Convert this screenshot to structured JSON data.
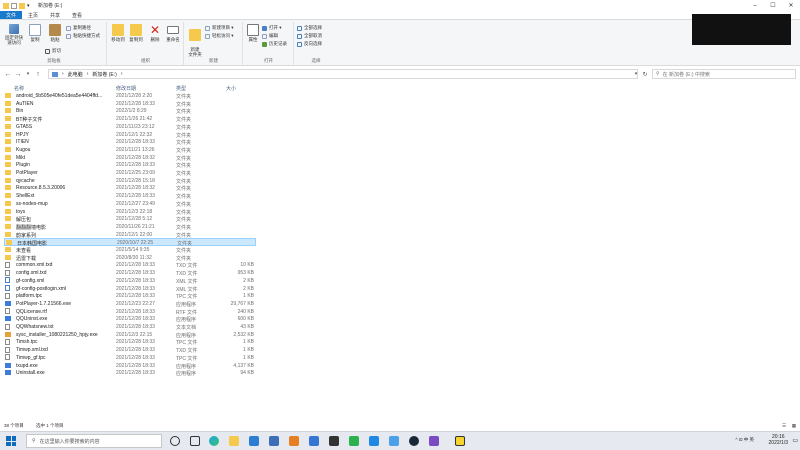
{
  "window": {
    "title": "新加卷 (E:)"
  },
  "tabs": [
    "文件",
    "主页",
    "共享",
    "查看"
  ],
  "ribbon": {
    "clipboard": {
      "name": "剪贴板",
      "pin": "固定到快速访问",
      "copy": "复制",
      "paste": "粘贴",
      "cut": "剪切",
      "copy_path": "复制路径",
      "paste_shortcut": "粘贴快捷方式"
    },
    "organize": {
      "name": "组织",
      "move_to": "移动到",
      "copy_to": "复制到",
      "delete": "删除",
      "rename": "重命名"
    },
    "new": {
      "name": "新建",
      "new_folder": "新建\n文件夹",
      "new_item": "新建项目 ▾",
      "easy_access": "轻松访问 ▾"
    },
    "open": {
      "name": "打开",
      "properties": "属性",
      "open": "打开 ▾",
      "edit": "编辑",
      "history": "历史记录"
    },
    "select": {
      "name": "选择",
      "select_all": "全部选择",
      "select_none": "全部取消",
      "invert": "反向选择"
    }
  },
  "address": {
    "path": [
      "此电脑",
      "新加卷 (E:)"
    ],
    "search_placeholder": "在 新加卷 (E:) 中搜索"
  },
  "columns": {
    "name": "名称",
    "date": "修改日期",
    "type": "类型",
    "size": "大小"
  },
  "files": [
    {
      "name": "android_5b505e40fe51dea5e4404ffd...",
      "date": "2021/12/28 2:20",
      "type": "文件夹",
      "size": "",
      "kind": "folder"
    },
    {
      "name": "AuTIEN",
      "date": "2021/12/28 18:33",
      "type": "文件夹",
      "size": "",
      "kind": "folder"
    },
    {
      "name": "Bin",
      "date": "2022/1/2 8:29",
      "type": "文件夹",
      "size": "",
      "kind": "folder"
    },
    {
      "name": "BT种子文件",
      "date": "2021/1/26 21:42",
      "type": "文件夹",
      "size": "",
      "kind": "folder"
    },
    {
      "name": "GTA5S",
      "date": "2021/11/23 23:12",
      "type": "文件夹",
      "size": "",
      "kind": "folder"
    },
    {
      "name": "HPJY",
      "date": "2021/12/1 22:32",
      "type": "文件夹",
      "size": "",
      "kind": "folder"
    },
    {
      "name": "ITIEN",
      "date": "2021/12/28 18:33",
      "type": "文件夹",
      "size": "",
      "kind": "folder"
    },
    {
      "name": "Kugou",
      "date": "2021/11/21 13:26",
      "type": "文件夹",
      "size": "",
      "kind": "folder"
    },
    {
      "name": "Mikt",
      "date": "2021/12/28 18:32",
      "type": "文件夹",
      "size": "",
      "kind": "folder"
    },
    {
      "name": "Plugin",
      "date": "2021/12/28 18:33",
      "type": "文件夹",
      "size": "",
      "kind": "folder"
    },
    {
      "name": "PotPlayer",
      "date": "2021/12/25 23:09",
      "type": "文件夹",
      "size": "",
      "kind": "folder"
    },
    {
      "name": "qycache",
      "date": "2021/12/28 15:18",
      "type": "文件夹",
      "size": "",
      "kind": "folder"
    },
    {
      "name": "Resource.8.5.3.20006",
      "date": "2021/12/28 18:32",
      "type": "文件夹",
      "size": "",
      "kind": "folder"
    },
    {
      "name": "ShellExt",
      "date": "2021/12/28 18:33",
      "type": "文件夹",
      "size": "",
      "kind": "folder"
    },
    {
      "name": "ss-nodes-mup",
      "date": "2021/12/27 23:49",
      "type": "文件夹",
      "size": "",
      "kind": "folder"
    },
    {
      "name": "toys",
      "date": "2021/12/3 22:18",
      "type": "文件夹",
      "size": "",
      "kind": "folder"
    },
    {
      "name": "解压包",
      "date": "2021/12/28 5:12",
      "type": "文件夹",
      "size": "",
      "kind": "folder"
    },
    {
      "name": "翻翻翻墙电影",
      "date": "2020/11/26 21:21",
      "type": "文件夹",
      "size": "",
      "kind": "folder"
    },
    {
      "name": "韵家系列",
      "date": "2021/12/1 22:00",
      "type": "文件夹",
      "size": "",
      "kind": "folder"
    },
    {
      "name": "日本韩国电影",
      "date": "2020/10/7 22:25",
      "type": "文件夹",
      "size": "",
      "kind": "folder",
      "selected": true
    },
    {
      "name": "未查看",
      "date": "2021/5/14 9:35",
      "type": "文件夹",
      "size": "",
      "kind": "folder"
    },
    {
      "name": "迅雷下载",
      "date": "2020/8/30 11:32",
      "type": "文件夹",
      "size": "",
      "kind": "folder"
    },
    {
      "name": "common.xml.txd",
      "date": "2021/12/28 18:33",
      "type": "TXD 文件",
      "size": "10 KB",
      "kind": "doc"
    },
    {
      "name": "config.xml.txd",
      "date": "2021/12/28 18:33",
      "type": "TXD 文件",
      "size": "953 KB",
      "kind": "doc"
    },
    {
      "name": "gf-config.xml",
      "date": "2021/12/28 18:33",
      "type": "XML 文件",
      "size": "2 KB",
      "kind": "xml"
    },
    {
      "name": "gf-config-postlogin.xml",
      "date": "2021/12/28 18:33",
      "type": "XML 文件",
      "size": "2 KB",
      "kind": "xml"
    },
    {
      "name": "platform.tpc",
      "date": "2021/12/28 18:33",
      "type": "TPC 文件",
      "size": "1 KB",
      "kind": "doc"
    },
    {
      "name": "PotPlayer-1.7.21566.exe",
      "date": "2021/12/23 22:27",
      "type": "应用程序",
      "size": "29,767 KB",
      "kind": "exe"
    },
    {
      "name": "QQLicense.rtf",
      "date": "2021/12/28 18:33",
      "type": "RTF 文件",
      "size": "240 KB",
      "kind": "doc"
    },
    {
      "name": "QQUninst.exe",
      "date": "2021/12/28 18:33",
      "type": "应用程序",
      "size": "600 KB",
      "kind": "exe"
    },
    {
      "name": "QQWhatsnew.txt",
      "date": "2021/12/28 18:33",
      "type": "文本文档",
      "size": "43 KB",
      "kind": "doc"
    },
    {
      "name": "sysc_installer_1080221250_hpjy.exe",
      "date": "2021/12/3 22:15",
      "type": "应用程序",
      "size": "2,532 KB",
      "kind": "exe2"
    },
    {
      "name": "Timsh.tpc",
      "date": "2021/12/28 18:33",
      "type": "TPC 文件",
      "size": "1 KB",
      "kind": "doc"
    },
    {
      "name": "Timwp.xml.txd",
      "date": "2021/12/28 18:33",
      "type": "TXD 文件",
      "size": "1 KB",
      "kind": "doc"
    },
    {
      "name": "Timwp_gf.tpc",
      "date": "2021/12/28 18:33",
      "type": "TPC 文件",
      "size": "1 KB",
      "kind": "doc"
    },
    {
      "name": "txupd.exe",
      "date": "2021/12/28 18:33",
      "type": "应用程序",
      "size": "4,137 KB",
      "kind": "exe"
    },
    {
      "name": "Uninstall.exe",
      "date": "2021/12/28 18:33",
      "type": "应用程序",
      "size": "94 KB",
      "kind": "exe"
    }
  ],
  "status": {
    "count": "38 个项目",
    "selected": "选中 1 个项目"
  },
  "taskbar": {
    "search_placeholder": "在这里输入你要搜索的内容",
    "tray_text": "^  ⊡  中 英",
    "time": "20:16",
    "date": "2022/1/3"
  },
  "colors": {
    "accent": "#1979ca",
    "selection": "#cce8ff",
    "folder": "#f5c94c"
  }
}
